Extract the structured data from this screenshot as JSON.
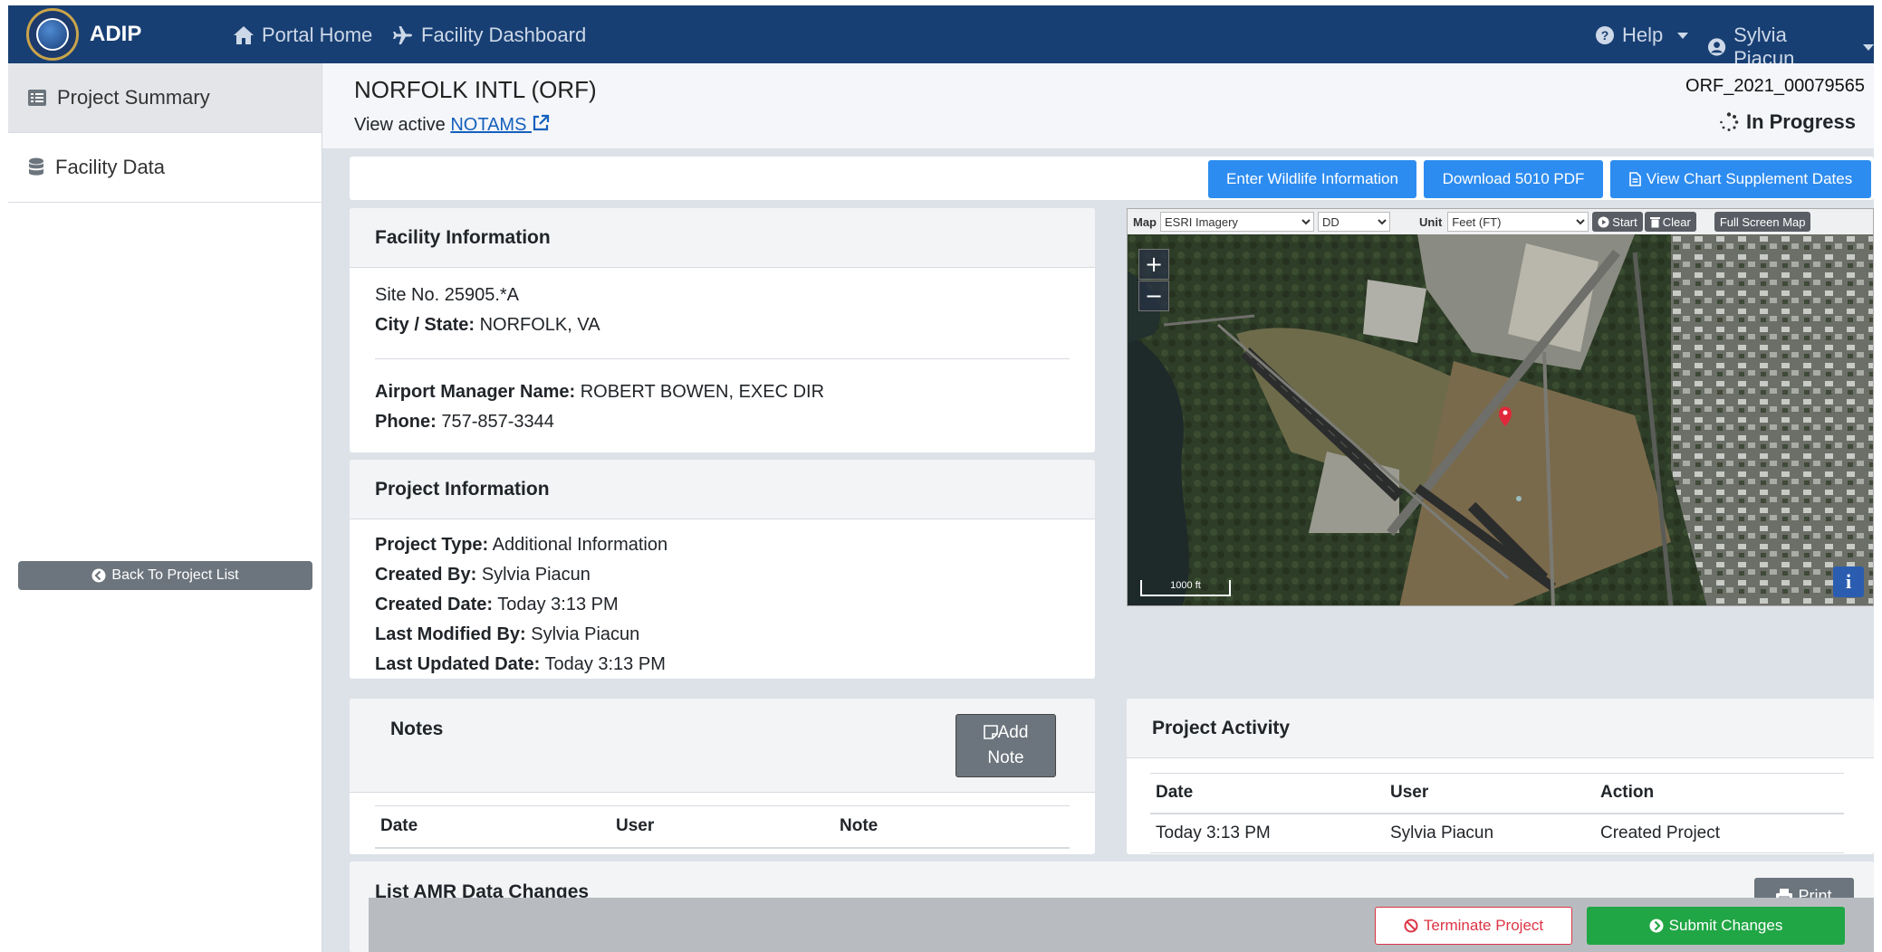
{
  "nav": {
    "brand": "ADIP",
    "portal_home": "Portal Home",
    "facility_dashboard": "Facility Dashboard",
    "help": "Help",
    "user": "Sylvia Piacun"
  },
  "sidebar": {
    "items": [
      {
        "label": "Project Summary",
        "icon": "list-icon"
      },
      {
        "label": "Facility Data",
        "icon": "database-icon"
      }
    ],
    "back_label": "Back To Project List"
  },
  "header": {
    "title": "NORFOLK INTL (ORF)",
    "notams_prefix": "View active",
    "notams_link": "NOTAMS",
    "project_id": "ORF_2021_00079565",
    "status": "In Progress"
  },
  "actions": {
    "wildlife": "Enter Wildlife Information",
    "download": "Download 5010 PDF",
    "chart": "View Chart Supplement Dates"
  },
  "facility": {
    "title": "Facility Information",
    "site_no": "Site No. 25905.*A",
    "city_label": "City / State:",
    "city_value": "NORFOLK, VA",
    "manager_label": "Airport Manager Name:",
    "manager_value": "ROBERT BOWEN, EXEC DIR",
    "phone_label": "Phone:",
    "phone_value": "757-857-3344"
  },
  "project": {
    "title": "Project Information",
    "type_label": "Project Type:",
    "type_value": "Additional Information",
    "created_by_label": "Created By:",
    "created_by_value": "Sylvia Piacun",
    "created_date_label": "Created Date:",
    "created_date_value": "Today 3:13 PM",
    "modified_by_label": "Last Modified By:",
    "modified_by_value": "Sylvia Piacun",
    "updated_label": "Last Updated Date:",
    "updated_value": "Today 3:13 PM"
  },
  "map": {
    "map_label": "Map",
    "layer": "ESRI Imagery",
    "coord": "DD",
    "unit_label": "Unit",
    "unit": "Feet (FT)",
    "start": "Start",
    "clear": "Clear",
    "fullscreen": "Full Screen Map",
    "scale": "1000 ft",
    "zoom_in": "+",
    "zoom_out": "−",
    "info": "i"
  },
  "notes": {
    "title": "Notes",
    "add_line1": "Add",
    "add_line2": "Note",
    "columns": [
      "Date",
      "User",
      "Note"
    ]
  },
  "activity": {
    "title": "Project Activity",
    "columns": [
      "Date",
      "User",
      "Action"
    ],
    "rows": [
      {
        "date": "Today 3:13 PM",
        "user": "Sylvia Piacun",
        "action": "Created Project"
      }
    ]
  },
  "amr": {
    "title": "List AMR Data Changes",
    "print": "Print"
  },
  "footer": {
    "terminate": "Terminate Project",
    "submit": "Submit Changes"
  }
}
